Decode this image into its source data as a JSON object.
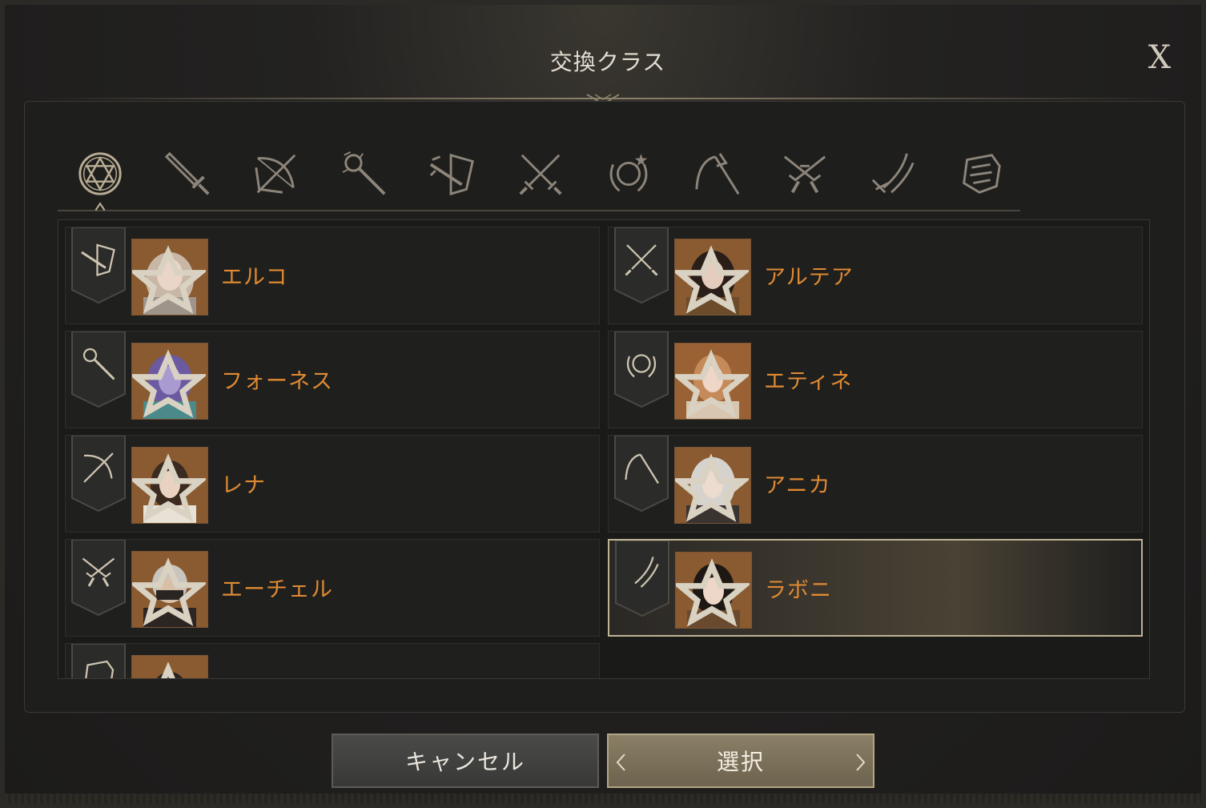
{
  "dialog": {
    "title": "交換クラス",
    "close_label": "X"
  },
  "tabs": [
    {
      "icon": "hexagram-icon",
      "selected": true
    },
    {
      "icon": "sword-icon",
      "selected": false
    },
    {
      "icon": "bow-icon",
      "selected": false
    },
    {
      "icon": "staff-icon",
      "selected": false
    },
    {
      "icon": "shield-weapon-icon",
      "selected": false
    },
    {
      "icon": "crossed-daggers-icon",
      "selected": false
    },
    {
      "icon": "orb-icon",
      "selected": false
    },
    {
      "icon": "scythe-icon",
      "selected": false
    },
    {
      "icon": "crossed-pistols-icon",
      "selected": false
    },
    {
      "icon": "claw-blade-icon",
      "selected": false
    },
    {
      "icon": "gauntlet-icon",
      "selected": false
    }
  ],
  "characters": [
    {
      "name": "エルコ",
      "class_icon": "shield-weapon-icon",
      "selected": false
    },
    {
      "name": "アルテア",
      "class_icon": "crossed-daggers-icon",
      "selected": false
    },
    {
      "name": "フォーネス",
      "class_icon": "staff-icon",
      "selected": false
    },
    {
      "name": "エティネ",
      "class_icon": "orb-icon",
      "selected": false
    },
    {
      "name": "レナ",
      "class_icon": "bow-icon",
      "selected": false
    },
    {
      "name": "アニカ",
      "class_icon": "scythe-icon",
      "selected": false
    },
    {
      "name": "エーチェル",
      "class_icon": "crossed-pistols-icon",
      "selected": false
    },
    {
      "name": "ラボニ",
      "class_icon": "claw-blade-icon",
      "selected": true
    },
    {
      "name": "",
      "class_icon": "gauntlet-icon",
      "selected": false
    }
  ],
  "buttons": {
    "cancel_label": "キャンセル",
    "select_label": "選択"
  },
  "colors": {
    "name_text": "#e08a32",
    "accent_gold": "#bfb394",
    "background": "#1e1e1d"
  }
}
